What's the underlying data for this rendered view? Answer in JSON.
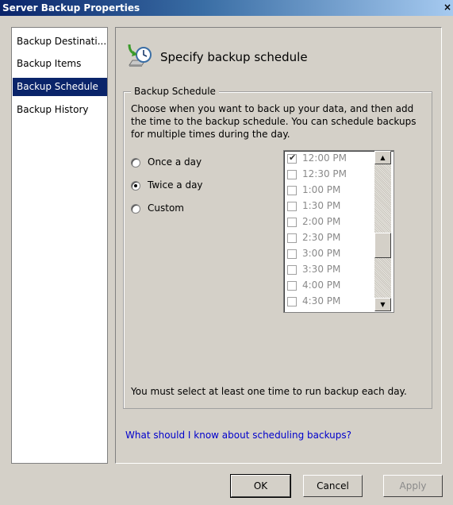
{
  "window": {
    "title": "Server Backup Properties",
    "close_glyph": "×"
  },
  "nav": {
    "items": [
      {
        "label": "Backup Destinati..."
      },
      {
        "label": "Backup Items"
      },
      {
        "label": "Backup Schedule"
      },
      {
        "label": "Backup History"
      }
    ],
    "selected": "Backup Schedule"
  },
  "header": {
    "title": "Specify backup schedule",
    "icon": "backup-clock-icon"
  },
  "group": {
    "legend": "Backup Schedule",
    "description": "Choose when you want to back up your data, and then add the time to the backup schedule. You can schedule backups for multiple times during the day."
  },
  "frequency": {
    "options": [
      {
        "label": "Once a day",
        "checked": false
      },
      {
        "label": "Twice a day",
        "checked": true
      },
      {
        "label": "Custom",
        "checked": false
      }
    ]
  },
  "times": [
    {
      "label": "12:00 PM",
      "checked": true
    },
    {
      "label": "12:30 PM",
      "checked": false
    },
    {
      "label": "1:00 PM",
      "checked": false
    },
    {
      "label": "1:30 PM",
      "checked": false
    },
    {
      "label": "2:00 PM",
      "checked": false
    },
    {
      "label": "2:30 PM",
      "checked": false
    },
    {
      "label": "3:00 PM",
      "checked": false
    },
    {
      "label": "3:30 PM",
      "checked": false
    },
    {
      "label": "4:00 PM",
      "checked": false
    },
    {
      "label": "4:30 PM",
      "checked": false
    }
  ],
  "scroll": {
    "up_glyph": "▲",
    "down_glyph": "▼"
  },
  "warning": "You must select at least one time to run backup each day.",
  "help_link": "What should I know about scheduling backups?",
  "buttons": {
    "ok": "OK",
    "cancel": "Cancel",
    "apply": "Apply"
  },
  "colors": {
    "selection": "#0a246a",
    "link": "#0000cc",
    "disabled_text": "#8a8a8a"
  }
}
